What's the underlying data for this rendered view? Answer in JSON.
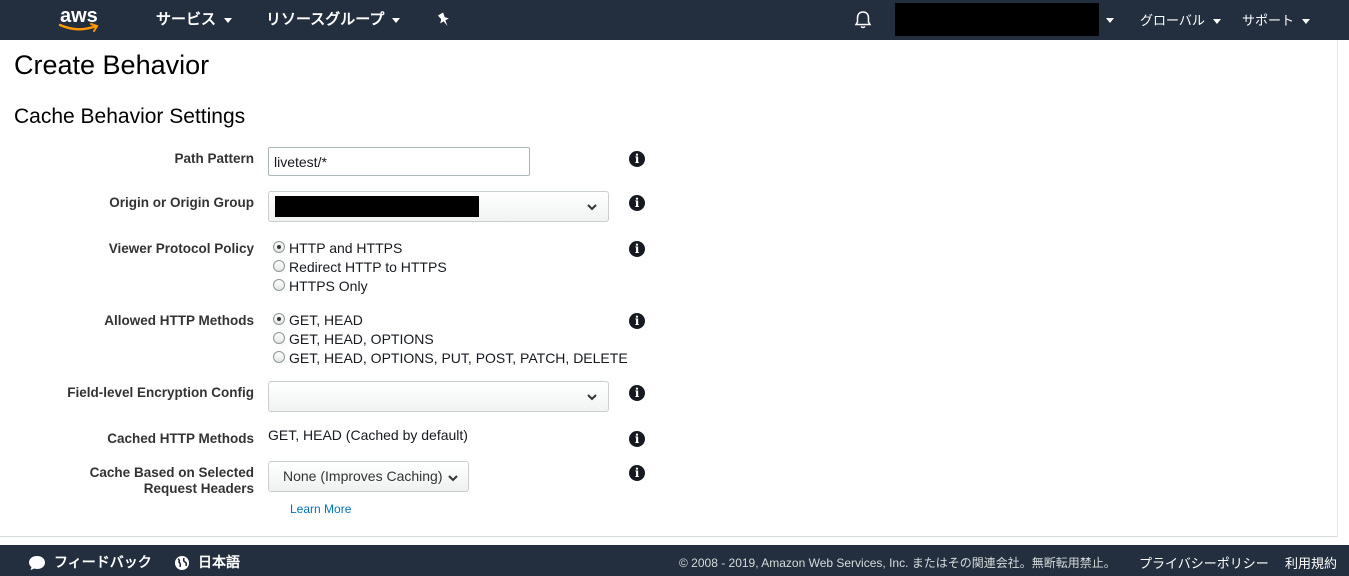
{
  "topnav": {
    "logo_text": "aws",
    "services_label": "サービス",
    "resource_groups_label": "リソースグループ",
    "region_label": "グローバル",
    "support_label": "サポート",
    "icons": [
      "pin-icon",
      "bell-icon",
      "chevron-down-icon"
    ],
    "background_color": "#232f3e"
  },
  "page": {
    "title": "Create Behavior",
    "section_title": "Cache Behavior Settings"
  },
  "form": {
    "path_pattern": {
      "label": "Path Pattern",
      "value": "livetest/*"
    },
    "origin": {
      "label": "Origin or Origin Group",
      "value": ""
    },
    "viewer_protocol": {
      "label": "Viewer Protocol Policy",
      "options": [
        "HTTP and HTTPS",
        "Redirect HTTP to HTTPS",
        "HTTPS Only"
      ],
      "selected": "HTTP and HTTPS"
    },
    "allowed_methods": {
      "label": "Allowed HTTP Methods",
      "options": [
        "GET, HEAD",
        "GET, HEAD, OPTIONS",
        "GET, HEAD, OPTIONS, PUT, POST, PATCH, DELETE"
      ],
      "selected": "GET, HEAD"
    },
    "fle_config": {
      "label": "Field-level Encryption Config",
      "value": ""
    },
    "cached_methods": {
      "label": "Cached HTTP Methods",
      "value": "GET, HEAD (Cached by default)"
    },
    "cache_headers": {
      "label_line1": "Cache Based on Selected",
      "label_line2": "Request Headers",
      "value": "None (Improves Caching)",
      "learn_more": "Learn More"
    },
    "info_icon_glyph": "i"
  },
  "footer": {
    "feedback_label": "フィードバック",
    "language_label": "日本語",
    "copyright": "© 2008 - 2019, Amazon Web Services, Inc. またはその関連会社。無断転用禁止。",
    "privacy_label": "プライバシーポリシー",
    "terms_label": "利用規約"
  },
  "colors": {
    "link": "#0073bb",
    "nav_bg": "#232f3e"
  }
}
